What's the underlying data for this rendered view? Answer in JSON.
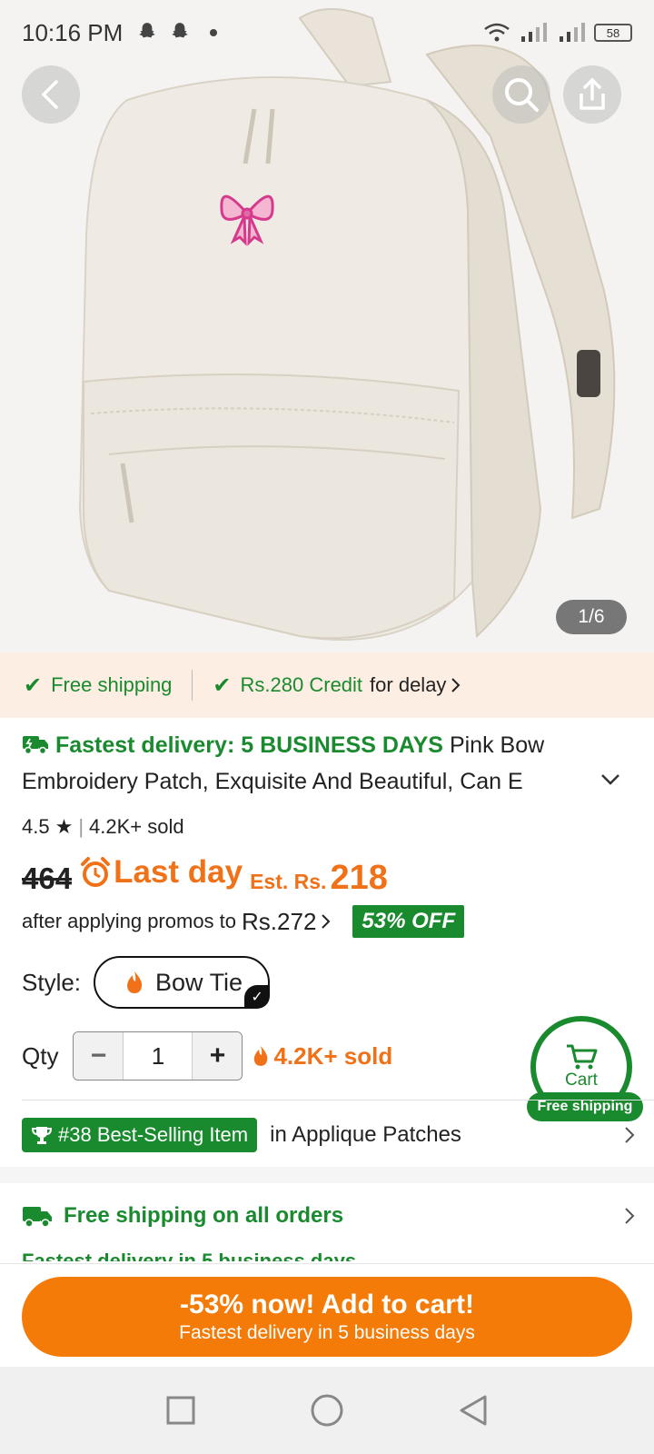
{
  "status_bar": {
    "time": "10:16 PM",
    "battery": "58",
    "icons": [
      "snapchat-icon",
      "snapchat-icon",
      "dot-icon",
      "wifi-icon",
      "signal-icon",
      "signal-icon",
      "battery-icon"
    ]
  },
  "gallery": {
    "counter": "1/6"
  },
  "shipping_strip": {
    "free_shipping": "Free shipping",
    "credit": "Rs.280 Credit",
    "credit_suffix": "for delay"
  },
  "product": {
    "fastest": "Fastest delivery: 5 BUSINESS DAYS",
    "title": "Pink Bow Embroidery Patch, Exquisite And Beautiful, Can E",
    "rating": "4.5",
    "sold": "4.2K+ sold",
    "old_price": "464",
    "last_day": "Last day",
    "est_label": "Est. Rs.",
    "est_price": "218",
    "promo_text": "after applying promos to",
    "promo_price": "Rs.272",
    "off_badge": "53% OFF"
  },
  "style": {
    "label": "Style:",
    "selected": "Bow Tie"
  },
  "qty": {
    "label": "Qty",
    "value": "1",
    "minus": "−",
    "plus": "+",
    "sold": "4.2K+ sold"
  },
  "cart_float": {
    "label": "Cart",
    "badge": "Free shipping"
  },
  "best_selling": {
    "badge": "#38 Best-Selling Item",
    "category": "in Applique Patches"
  },
  "free_shipping_section": {
    "title": "Free shipping on all orders",
    "subtitle": "Fastest delivery in 5 business days"
  },
  "cta": {
    "line1": "-53% now! Add to cart!",
    "line2": "Fastest delivery in 5 business days"
  },
  "colors": {
    "green": "#1a8a2e",
    "orange": "#f07118",
    "cta": "#f57b08",
    "strip_bg": "#fdeee3"
  }
}
